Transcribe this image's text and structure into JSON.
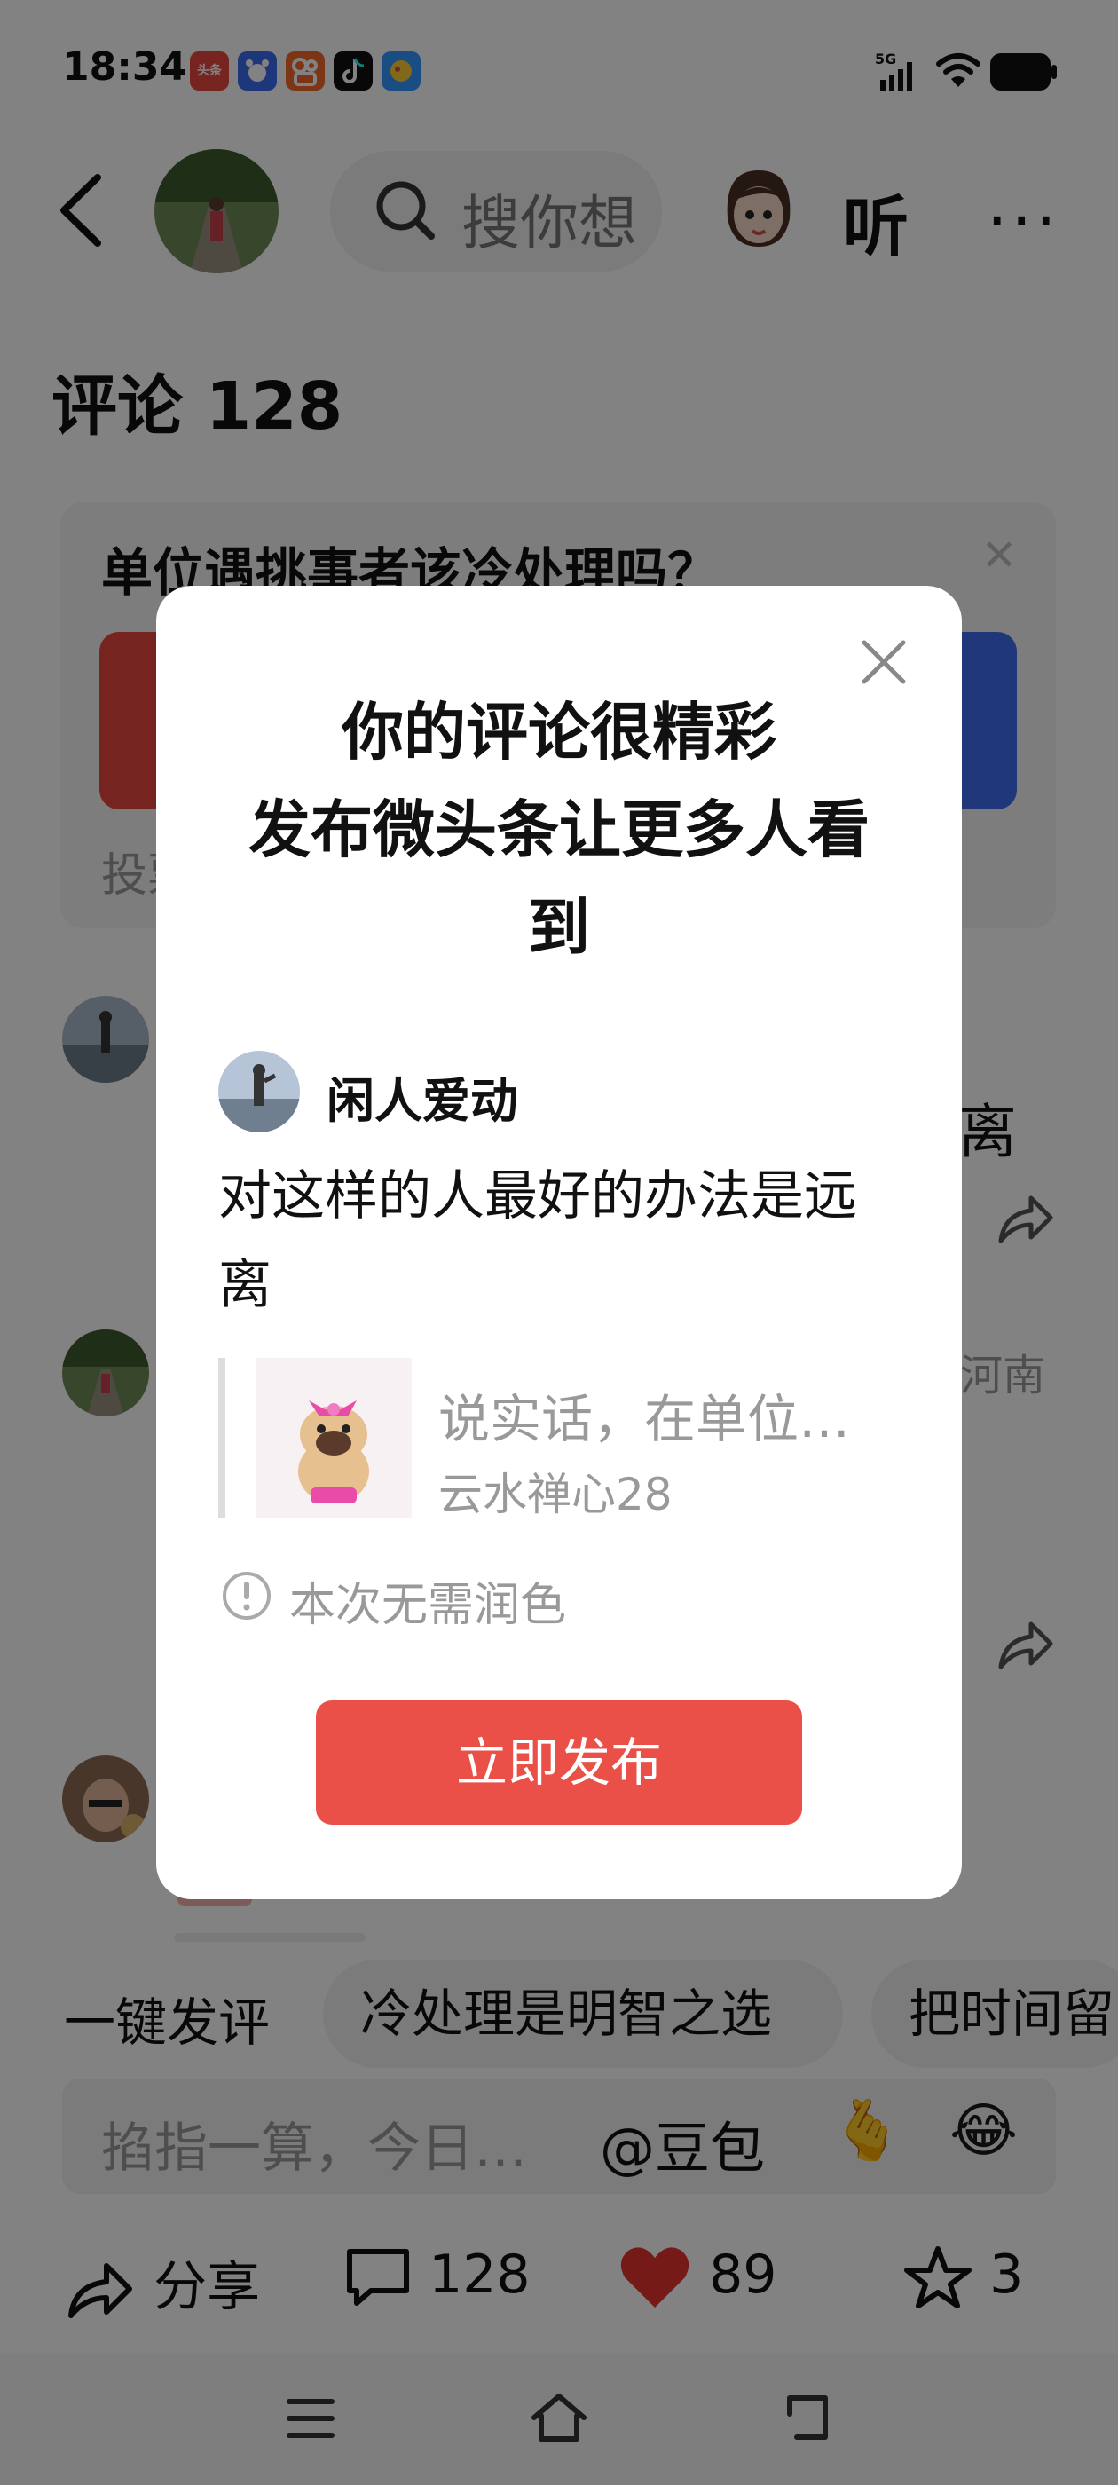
{
  "status_bar": {
    "time": "18:34",
    "app_icons": [
      {
        "name": "toutiao-icon",
        "label": "头条",
        "color": "#e8483d"
      },
      {
        "name": "baidu-icon",
        "label": "",
        "color": "#3a6df0"
      },
      {
        "name": "kuaishou-icon",
        "label": "",
        "color": "#f36a2a"
      },
      {
        "name": "douyin-icon",
        "label": "",
        "color": "#111111"
      },
      {
        "name": "game-icon",
        "label": "",
        "color": "#3399ff"
      }
    ],
    "network": "5G"
  },
  "header": {
    "search_placeholder": "搜你想",
    "listen_label": "听",
    "more_label": "···"
  },
  "comments_title": "评论 128",
  "poll": {
    "question": "单位遇挑事者该冷处理吗？",
    "vote_label": "投票"
  },
  "background_comments": {
    "first_tail": "离",
    "location": "河南"
  },
  "quick_replies": {
    "label": "一键发评",
    "chips": [
      "冷处理是明智之选",
      "把时间留"
    ]
  },
  "input_bar": {
    "placeholder": "掐指一算，今日…",
    "mention": "@豆包",
    "emojis": [
      "🫰",
      "😂"
    ]
  },
  "actions": {
    "share_label": "分享",
    "comment_count": "128",
    "like_count": "89",
    "fav_count": "3"
  },
  "modal": {
    "title_line1": "你的评论很精彩",
    "title_line2": "发布微头条让更多人看到",
    "username": "闲人爱动",
    "comment_text": "对这样的人最好的办法是远离",
    "quote_title": "说实话，在单位…",
    "quote_author": "云水禅心28",
    "polish_note": "本次无需润色",
    "publish_label": "立即发布",
    "accent_color": "#ea5047"
  }
}
